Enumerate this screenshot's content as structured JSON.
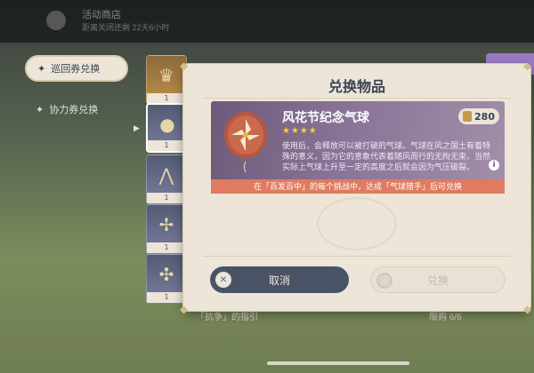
{
  "background": {
    "event_title": "活动商店",
    "event_time": "距离关闭还剩 22天6小时",
    "bottom_row_label": "「抗争」的指引",
    "bottom_row_progress": "限购 6/6"
  },
  "sidebar": {
    "items": [
      {
        "label": "巡回券兑换",
        "active": true
      },
      {
        "label": "协力券兑换",
        "active": false
      }
    ]
  },
  "item_list": {
    "counts": [
      "1",
      "1",
      "1",
      "1",
      "1"
    ]
  },
  "modal": {
    "title": "兑换物品",
    "item": {
      "name": "风花节纪念气球",
      "stars": "★★★★",
      "cost": "280",
      "description": "使用后，会释放可以被打破的气球。气球在风之国土有着特殊的意义，因为它的意象代表着随风而行的无拘无束，当然实际上气球上升至一定的高度之后就会因为气压破裂。",
      "requirement": "在「百发百中」的每个挑战中，达成「气球猎手」后可兑换"
    },
    "buttons": {
      "cancel": "取消",
      "confirm": "兑换"
    }
  },
  "colors": {
    "modal_bg": "#ece5d8",
    "panel_purple": "#8a7398",
    "requirement_bar": "#e07b5f",
    "cancel_button": "#4a5366",
    "star_gold": "#ffcc33"
  }
}
